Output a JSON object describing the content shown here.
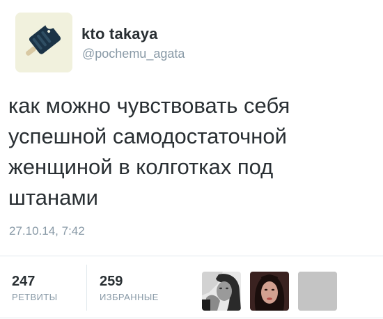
{
  "author": {
    "name": "kto takaya",
    "handle": "@pochemu_agata",
    "avatar_icon": "popsicle-icon"
  },
  "tweet": {
    "text": "как можно чувствовать себя\nуспешной самодостаточной\nженщиной в колготках под\nштанами",
    "timestamp": "27.10.14, 7:42"
  },
  "stats": {
    "retweets": {
      "count": "247",
      "label": "РЕТВИТЫ"
    },
    "favorites": {
      "count": "259",
      "label": "ИЗБРАННЫЕ"
    }
  },
  "favorited_by": [
    {
      "kind": "photo",
      "icon": "user-photo-icon"
    },
    {
      "kind": "photo",
      "icon": "user-photo-icon"
    },
    {
      "kind": "placeholder",
      "icon": "default-avatar-icon"
    }
  ],
  "colors": {
    "text": "#292f33",
    "secondary": "#8899a6",
    "divider": "#e1e8ed",
    "avatar_bg": "#f1f1dd"
  }
}
